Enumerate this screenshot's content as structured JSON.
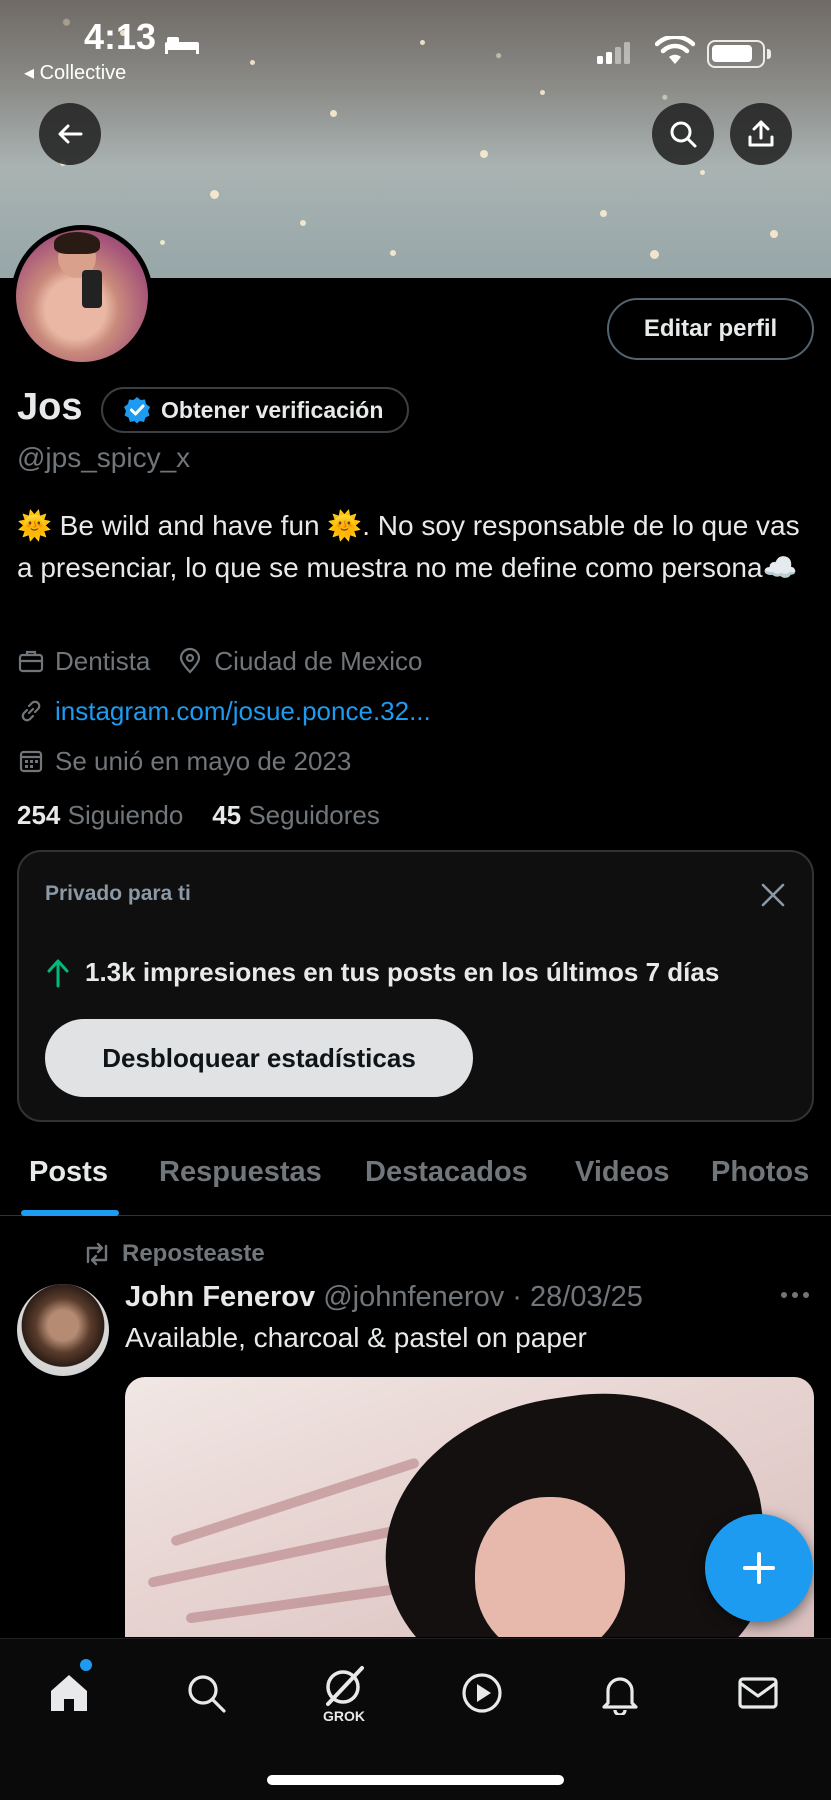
{
  "status_bar": {
    "time": "4:13",
    "back_app": "◂ Collective"
  },
  "profile": {
    "edit_label": "Editar perfil",
    "name": "Jos",
    "verify_label": "Obtener verificación",
    "handle": "@jps_spicy_x",
    "bio": "🌞 Be wild and have fun 🌞. No soy responsable de lo que vas a presenciar, lo que se muestra no me define como persona☁️",
    "profession": "Dentista",
    "location": "Ciudad de Mexico",
    "link": "instagram.com/josue.ponce.32...",
    "joined": "Se unió en mayo de 2023",
    "following_count": "254",
    "following_label": "Siguiendo",
    "followers_count": "45",
    "followers_label": "Seguidores"
  },
  "insights_card": {
    "title": "Privado para ti",
    "stat": "1.3k impresiones en tus posts en los últimos 7 días",
    "button": "Desbloquear estadísticas"
  },
  "tabs": [
    {
      "label": "Posts",
      "active": true
    },
    {
      "label": "Respuestas",
      "active": false
    },
    {
      "label": "Destacados",
      "active": false
    },
    {
      "label": "Videos",
      "active": false
    },
    {
      "label": "Photos",
      "active": false
    }
  ],
  "post": {
    "repost_label": "Reposteaste",
    "author_name": "John Fenerov",
    "author_handle": "@johnfenerov",
    "separator": " · ",
    "date": "28/03/25",
    "text": "Available, charcoal & pastel on paper"
  },
  "bottom_nav": {
    "items": [
      "home-icon",
      "search-icon",
      "grok-icon",
      "video-icon",
      "bell-icon",
      "mail-icon"
    ],
    "grok_label": "GROK"
  },
  "colors": {
    "accent": "#1d9bf0",
    "background": "#000000",
    "muted_text": "#71767b"
  }
}
